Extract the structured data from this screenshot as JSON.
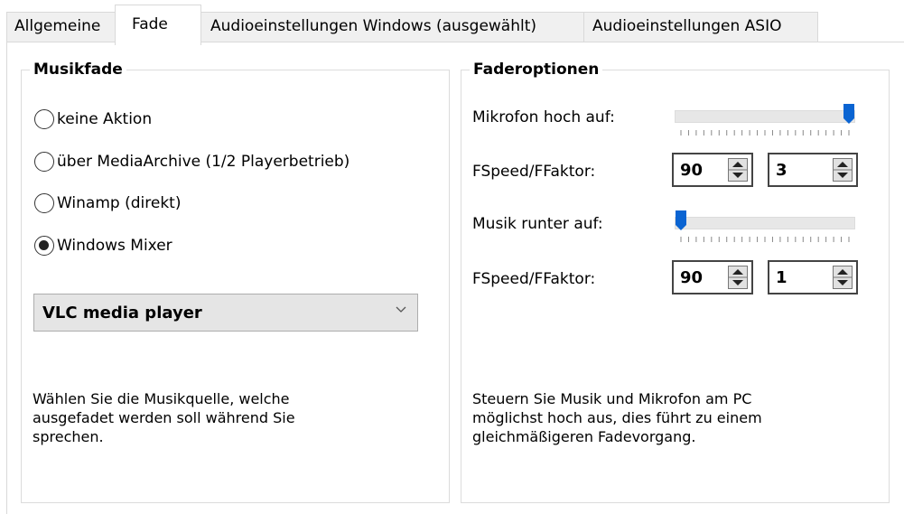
{
  "tabs": [
    {
      "label": "Allgemeine"
    },
    {
      "label": "Fade"
    },
    {
      "label": "Audioeinstellungen Windows (ausgewählt)"
    },
    {
      "label": "Audioeinstellungen ASIO"
    }
  ],
  "active_tab": "Fade",
  "musikfade": {
    "title": "Musikfade",
    "options": [
      {
        "label": "keine Aktion",
        "checked": false
      },
      {
        "label": "über MediaArchive (1/2 Playerbetrieb)",
        "checked": false
      },
      {
        "label": "Winamp (direkt)",
        "checked": false
      },
      {
        "label": "Windows Mixer",
        "checked": true
      }
    ],
    "mixer_source": "VLC media player",
    "help_lines": [
      "Wählen Sie die Musikquelle, welche",
      "ausgefadet werden soll während Sie",
      "sprechen."
    ]
  },
  "faderoptionen": {
    "title": "Faderoptionen",
    "mikrofon_label": "Mikrofon hoch auf:",
    "mikrofon_level": 1.0,
    "fspeed1_label": "FSpeed/FFaktor:",
    "fspeed1_value": "90",
    "ffaktor1_value": "3",
    "musik_label": "Musik runter auf:",
    "musik_level": 0.0,
    "fspeed2_label": "FSpeed/FFaktor:",
    "fspeed2_value": "90",
    "ffaktor2_value": "1",
    "help_lines": [
      "Steuern Sie Musik und Mikrofon am PC",
      "möglichst hoch aus, dies führt zu einem",
      "gleichmäßigeren Fadevorgang."
    ]
  },
  "colors": {
    "slider_thumb": "#0a64d2",
    "tab_border": "#d9d9d9",
    "select_bg": "#e5e5e5"
  }
}
